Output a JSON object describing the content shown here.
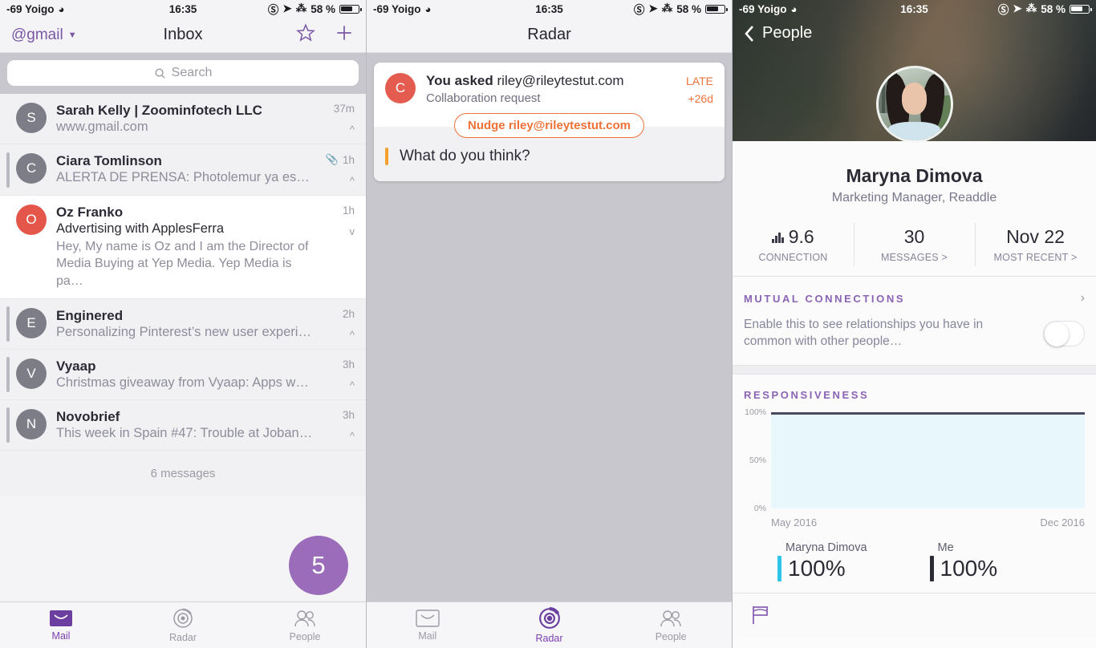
{
  "status_bar": {
    "carrier": "-69 Yoigo",
    "time": "16:35",
    "battery": "58 %"
  },
  "mail": {
    "account": "@gmail",
    "title": "Inbox",
    "search_placeholder": "Search",
    "messages_count": "6 messages",
    "badge": "5",
    "rows": [
      {
        "initial": "S",
        "color": "#7d7d87",
        "sender": "Sarah Kelly | Zoominfotech LLC",
        "subject": "www.gmail.com",
        "time": "37m",
        "chevron": "^",
        "snippet": "",
        "attachment": false
      },
      {
        "initial": "C",
        "color": "#7d7d87",
        "sender": "Ciara Tomlinson",
        "subject": "ALERTA DE PRENSA: Photolemur ya está dis…",
        "time": "1h",
        "chevron": "^",
        "snippet": "",
        "attachment": true
      },
      {
        "initial": "O",
        "color": "#e4564a",
        "sender": "Oz Franko",
        "subject": "Advertising with ApplesFerra",
        "time": "1h",
        "chevron": "v",
        "snippet": "Hey, My name is Oz and I am the Director of Media Buying at Yep Media. Yep Media is pa…",
        "attachment": false
      },
      {
        "initial": "E",
        "color": "#7d7d87",
        "sender": "Enginered",
        "subject": "Personalizing Pinterest’s new user experien…",
        "time": "2h",
        "chevron": "^",
        "snippet": "",
        "attachment": false
      },
      {
        "initial": "V",
        "color": "#7d7d87",
        "sender": "Vyaap",
        "subject": "Christmas giveaway from Vyaap: Apps wort…",
        "time": "3h",
        "chevron": "^",
        "snippet": "",
        "attachment": false
      },
      {
        "initial": "N",
        "color": "#7d7d87",
        "sender": "Novobrief",
        "subject": "This week in Spain #47: Trouble at Jobandta…",
        "time": "3h",
        "chevron": "^",
        "snippet": "",
        "attachment": false
      }
    ]
  },
  "radar": {
    "title": "Radar",
    "card": {
      "initial": "C",
      "title_bold": "You asked",
      "title_rest": "riley@rileytestut.com",
      "subtitle": "Collaboration request",
      "status": "LATE",
      "overdue": "+26d",
      "nudge_label": "Nudge riley@rileytestut.com",
      "question": "What do you think?"
    }
  },
  "people": {
    "back_label": "People",
    "name": "Maryna Dimova",
    "role": "Marketing Manager, Readdle",
    "stats": [
      {
        "value": "9.6",
        "label": "CONNECTION",
        "icon": "bars-icon"
      },
      {
        "value": "30",
        "label": "MESSAGES >"
      },
      {
        "value": "Nov 22",
        "label": "MOST RECENT >"
      }
    ],
    "mutual": {
      "heading": "MUTUAL CONNECTIONS",
      "description": "Enable this to see relationships you have in common with other people…",
      "toggle_on": false
    },
    "responsiveness": {
      "heading": "RESPONSIVENESS"
    }
  },
  "chart_data": {
    "type": "area",
    "title": "RESPONSIVENESS",
    "x": [
      "May 2016",
      "Dec 2016"
    ],
    "series": [
      {
        "name": "Maryna Dimova",
        "values": [
          100,
          100
        ],
        "color": "#4a4a60",
        "summary": "100%",
        "swatch": "#2ec5e8"
      },
      {
        "name": "Me",
        "values": [
          100,
          100
        ],
        "color": "#2b2b35",
        "summary": "100%",
        "swatch": "#2b2b35"
      }
    ],
    "ylabel": "",
    "xlabel": "",
    "ylim": [
      0,
      100
    ],
    "yticks": [
      "100%",
      "50%",
      "0%"
    ],
    "grid": false,
    "legend": "bottom",
    "fill_color": "#e8f7fb"
  },
  "tabs": [
    {
      "label": "Mail",
      "icon": "envelope-icon"
    },
    {
      "label": "Radar",
      "icon": "radar-icon"
    },
    {
      "label": "People",
      "icon": "people-icon"
    }
  ]
}
